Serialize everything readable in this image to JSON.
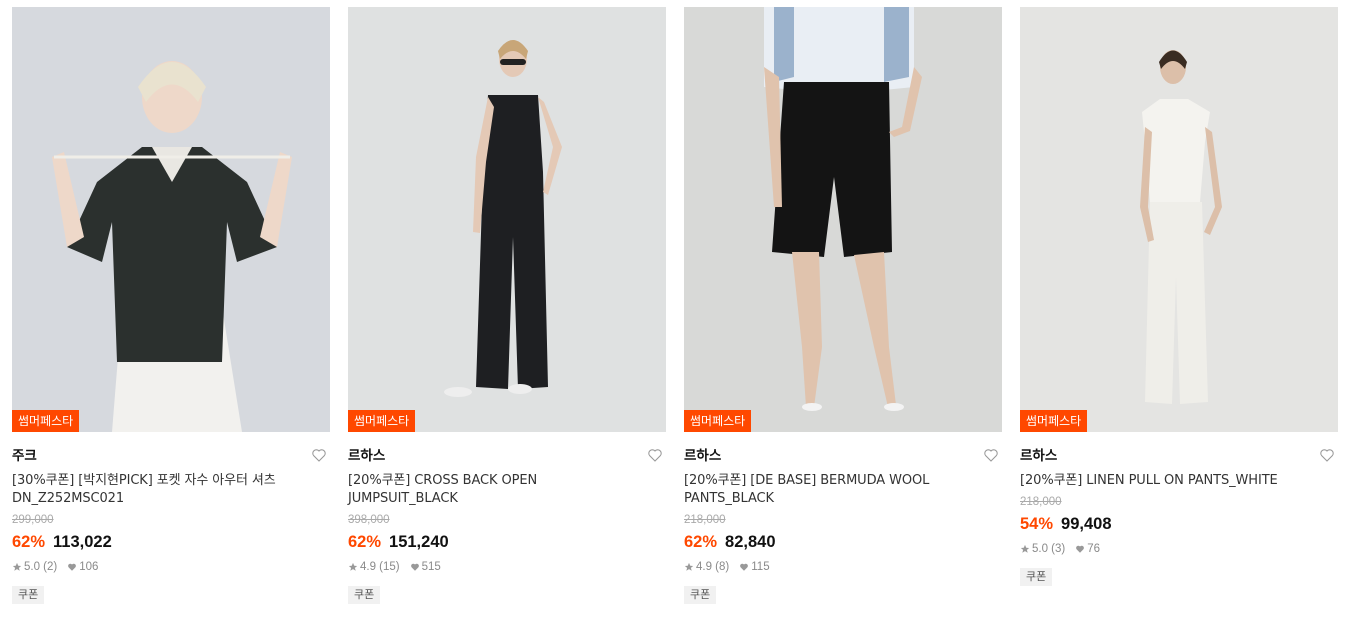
{
  "products": [
    {
      "badge": "썸머페스타",
      "brand": "주크",
      "title": "[30%쿠폰] [박지현PICK] 포켓 자수 아우터 셔츠 DN_Z252MSC021",
      "original_price": "299,000",
      "discount": "62%",
      "price": "113,022",
      "rating": "5.0 (2)",
      "likes": "106",
      "tag": "쿠폰",
      "image_icon": "model-photo-black-shirt-white-dress"
    },
    {
      "badge": "썸머페스타",
      "brand": "르하스",
      "title": "[20%쿠폰] CROSS BACK OPEN JUMPSUIT_BLACK",
      "original_price": "398,000",
      "discount": "62%",
      "price": "151,240",
      "rating": "4.9 (15)",
      "likes": "515",
      "tag": "쿠폰",
      "image_icon": "model-photo-black-jumpsuit"
    },
    {
      "badge": "썸머페스타",
      "brand": "르하스",
      "title": "[20%쿠폰] [DE BASE] BERMUDA WOOL PANTS_BLACK",
      "original_price": "218,000",
      "discount": "62%",
      "price": "82,840",
      "rating": "4.9 (8)",
      "likes": "115",
      "tag": "쿠폰",
      "image_icon": "model-photo-black-bermuda-shorts"
    },
    {
      "badge": "썸머페스타",
      "brand": "르하스",
      "title": "[20%쿠폰] LINEN PULL ON PANTS_WHITE",
      "original_price": "218,000",
      "discount": "54%",
      "price": "99,408",
      "rating": "5.0 (3)",
      "likes": "76",
      "tag": "쿠폰",
      "image_icon": "model-photo-white-linen-pants"
    }
  ],
  "colors": {
    "accent": "#ff4800",
    "muted": "#8a8a8a",
    "tag_bg": "#f1f1f1"
  }
}
